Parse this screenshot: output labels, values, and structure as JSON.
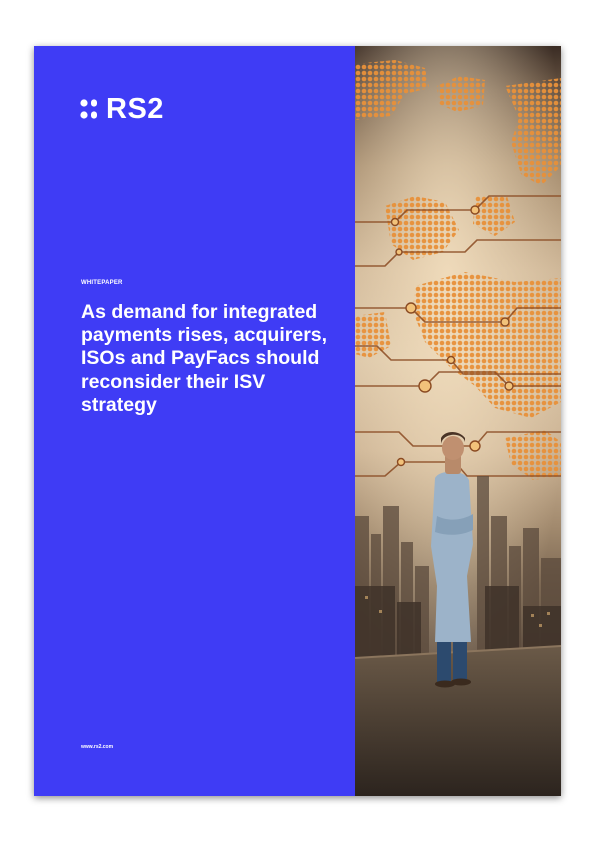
{
  "brand": {
    "logo_text": "RS2"
  },
  "cover": {
    "eyebrow": "WHITEPAPER",
    "headline": "As demand for integrated payments rises, acquirers, ISOs and PayFacs should reconsider their ISV strategy",
    "url": "www.rs2.com"
  },
  "colors": {
    "panel": "#3f3cf5",
    "text": "#ffffff",
    "dots": "#e8913a"
  },
  "photo": {
    "description_icon": "city-skyline-photo"
  }
}
